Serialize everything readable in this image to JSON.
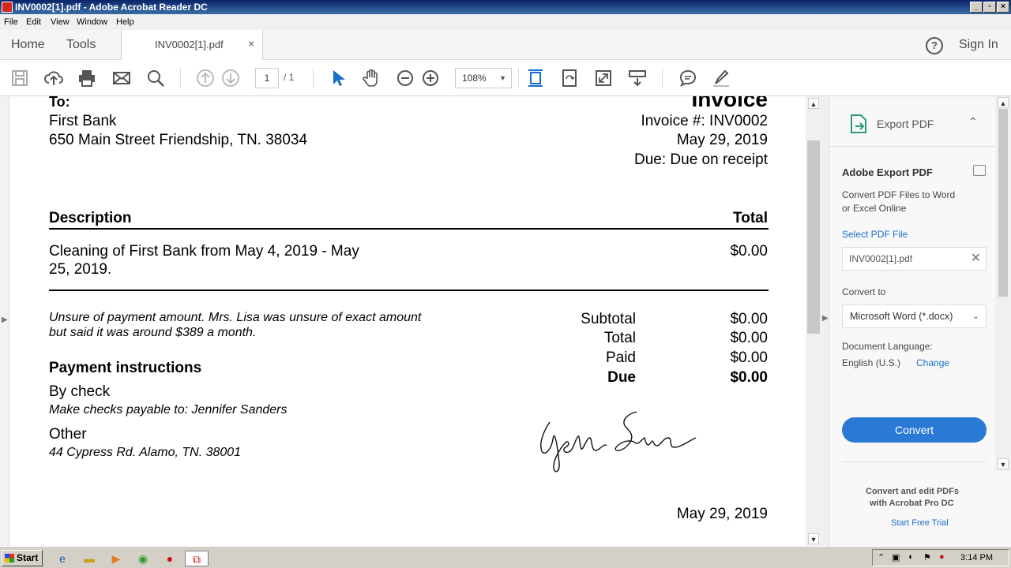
{
  "window": {
    "title": "INV0002[1].pdf - Adobe Acrobat Reader DC"
  },
  "menu": {
    "items": [
      "File",
      "Edit",
      "View",
      "Window",
      "Help"
    ]
  },
  "tabs": {
    "home": "Home",
    "tools": "Tools",
    "doc_tab": "INV0002[1].pdf",
    "close": "×",
    "sign_in": "Sign In",
    "help": "?"
  },
  "toolbar": {
    "page_current": "1",
    "page_total": "/ 1",
    "zoom": "108%"
  },
  "invoice": {
    "to_label": "To:",
    "to_name": "First Bank",
    "to_address": "650 Main Street Friendship, TN. 38034",
    "title": "Invoice",
    "number": "Invoice #: INV0002",
    "date": "May 29, 2019",
    "due_terms": "Due: Due on receipt",
    "col_description": "Description",
    "col_total": "Total",
    "line_desc_1": "Cleaning of First Bank from May 4, 2019 - May",
    "line_desc_2": "25, 2019.",
    "line_total": "$0.00",
    "note_1": "Unsure of payment amount. Mrs. Lisa was unsure of exact amount",
    "note_2": "but said it was around $389 a month.",
    "summary": [
      {
        "label": "Subtotal",
        "value": "$0.00"
      },
      {
        "label": "Total",
        "value": "$0.00"
      },
      {
        "label": "Paid",
        "value": "$0.00"
      },
      {
        "label": "Due",
        "value": "$0.00"
      }
    ],
    "payment_heading": "Payment instructions",
    "by_check": "By check",
    "check_payable": "Make checks payable to: Jennifer Sanders",
    "other": "Other",
    "other_address": "44 Cypress Rd. Alamo, TN. 38001",
    "signature_date": "May 29, 2019"
  },
  "export_pane": {
    "header": "Export PDF",
    "title": "Adobe Export PDF",
    "desc_1": "Convert PDF Files to Word",
    "desc_2": "or Excel Online",
    "select_file": "Select PDF File",
    "file_name": "INV0002[1].pdf",
    "convert_to_label": "Convert to",
    "convert_to_value": "Microsoft Word (*.docx)",
    "doc_lang_label": "Document Language:",
    "doc_lang_value": "English (U.S.)",
    "change": "Change",
    "convert_button": "Convert",
    "promo_1": "Convert and edit PDFs",
    "promo_2": "with Acrobat Pro DC",
    "trial": "Start Free Trial"
  },
  "taskbar": {
    "start": "Start",
    "clock": "3:14 PM"
  },
  "colors": {
    "accent": "#2a7ad5",
    "titlebar": "#0a246a",
    "link": "#1a6dc8"
  }
}
